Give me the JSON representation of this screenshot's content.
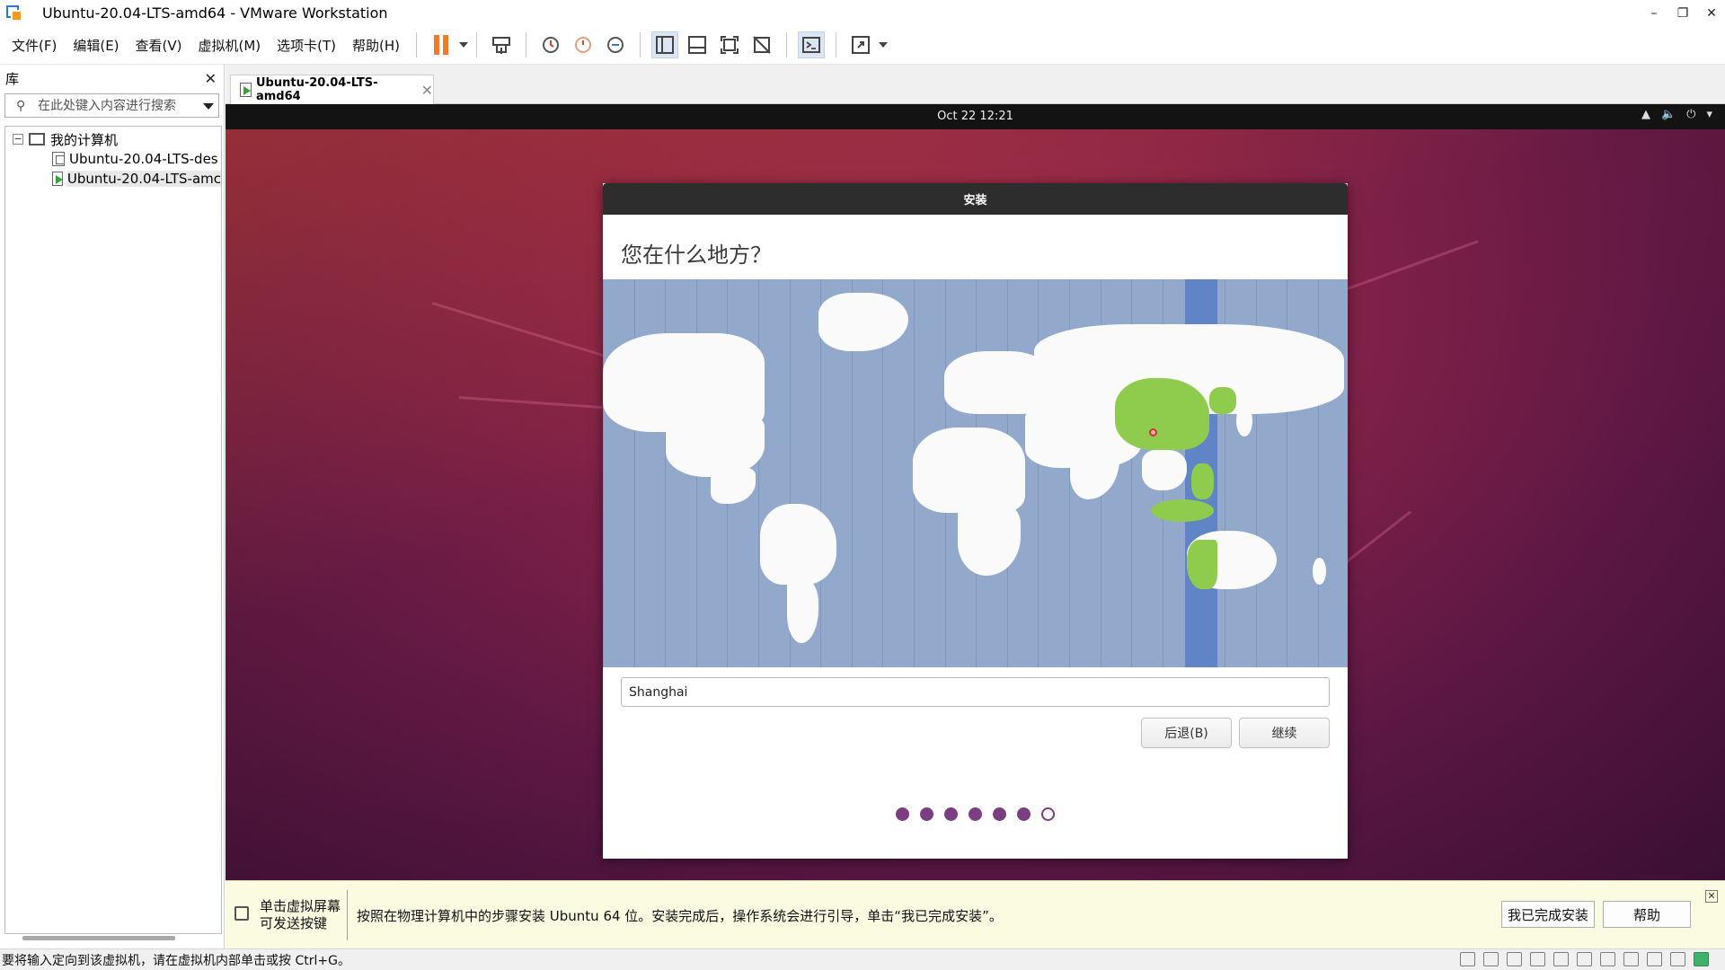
{
  "window": {
    "title": "Ubuntu-20.04-LTS-amd64 - VMware Workstation",
    "controls": [
      "–",
      "❐",
      "✕"
    ]
  },
  "menu": [
    "文件(F)",
    "编辑(E)",
    "查看(V)",
    "虚拟机(M)",
    "选项卡(T)",
    "帮助(H)"
  ],
  "toolbar_icons": [
    "pause-icon",
    "send-ctrl-alt-del-icon",
    "snapshot-icon",
    "revert-snapshot-icon",
    "snapshot-manager-icon",
    "library-view-icon",
    "thumbnail-view-icon",
    "fullscreen-icon",
    "unity-icon",
    "console-icon",
    "stretch-icon"
  ],
  "library": {
    "title": "库",
    "close": "✕",
    "search_placeholder": "在此处键入内容进行搜索",
    "tree": {
      "root": "我的计算机",
      "items": [
        "Ubuntu-20.04-LTS-des",
        "Ubuntu-20.04-LTS-amc"
      ]
    }
  },
  "vm_tab": {
    "label": "Ubuntu-20.04-LTS-amd64",
    "close": "✕"
  },
  "guest": {
    "topbar": {
      "clock": "Oct 22  12:21",
      "tray_icons": [
        "network-icon",
        "volume-icon",
        "power-icon",
        "menu-caret-icon"
      ]
    },
    "installer": {
      "window_title": "安装",
      "heading": "您在什么地方？",
      "timezone_value": "Shanghai",
      "back_button": "后退(B)",
      "continue_button": "继续",
      "progress": {
        "total": 7,
        "completed": 6
      }
    }
  },
  "hintbar": {
    "left_line1": "单击虚拟屏幕",
    "left_line2": "可发送按键",
    "message": "按照在物理计算机中的步骤安装 Ubuntu 64 位。安装完成后，操作系统会进行引导，单击“我已完成安装”。",
    "finish_button": "我已完成安装",
    "help_button": "帮助",
    "close": "✕"
  },
  "statusbar": {
    "text": "要将输入定向到该虚拟机，请在虚拟机内部单击或按 Ctrl+G。"
  }
}
